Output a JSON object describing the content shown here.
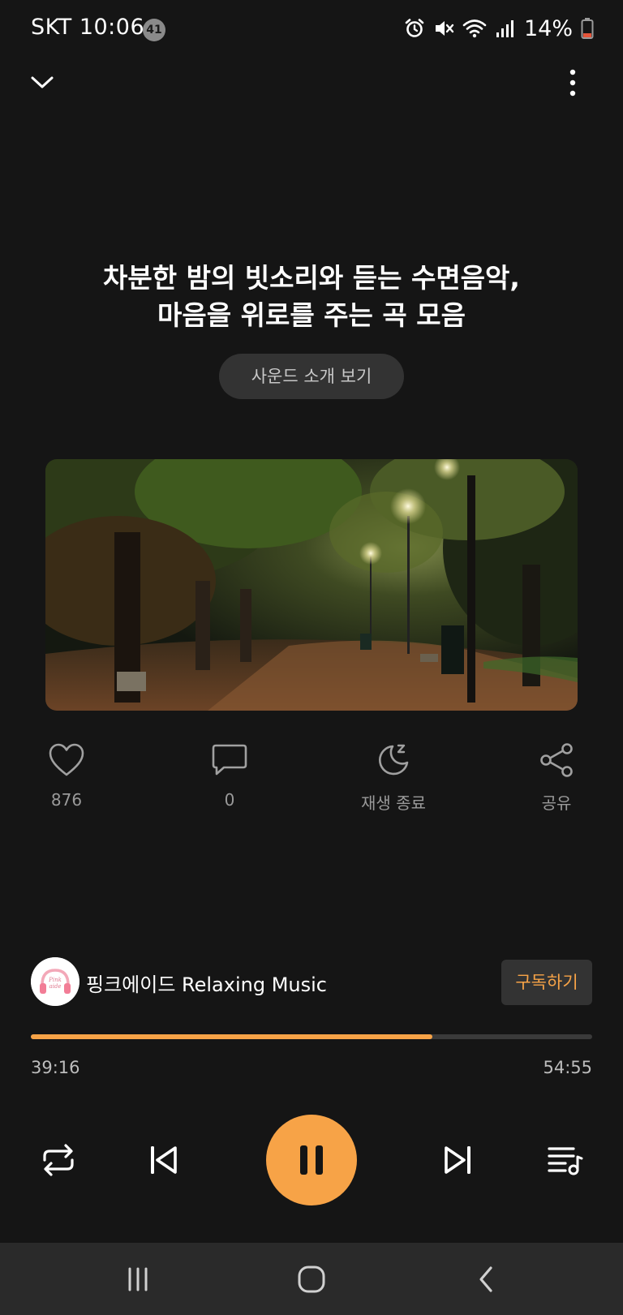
{
  "status_bar": {
    "carrier_time": "SKT 10:06",
    "notification_count": "41",
    "battery": "14%",
    "icons": [
      "alarm-icon",
      "mute-icon",
      "wifi-icon",
      "signal-icon",
      "battery-icon"
    ]
  },
  "header": {
    "collapse_icon": "chevron-down-icon",
    "more_icon": "more-vertical-icon"
  },
  "track": {
    "title_line1": "차분한 밤의 빗소리와 듣는 수면음악,",
    "title_line2": "마음을 위로를 주는 곡 모음",
    "intro_button": "사운드 소개 보기"
  },
  "actions": {
    "like_count": "876",
    "comment_count": "0",
    "sleep_timer_label": "재생 종료",
    "share_label": "공유"
  },
  "channel": {
    "name": "핑크에이드 Relaxing Music",
    "subscribe_label": "구독하기",
    "avatar_text": "Pink aide"
  },
  "playback": {
    "elapsed": "39:16",
    "total": "54:55",
    "progress_fraction": 0.716
  },
  "colors": {
    "accent": "#f7a347",
    "background": "#151515",
    "surface": "#333333"
  }
}
